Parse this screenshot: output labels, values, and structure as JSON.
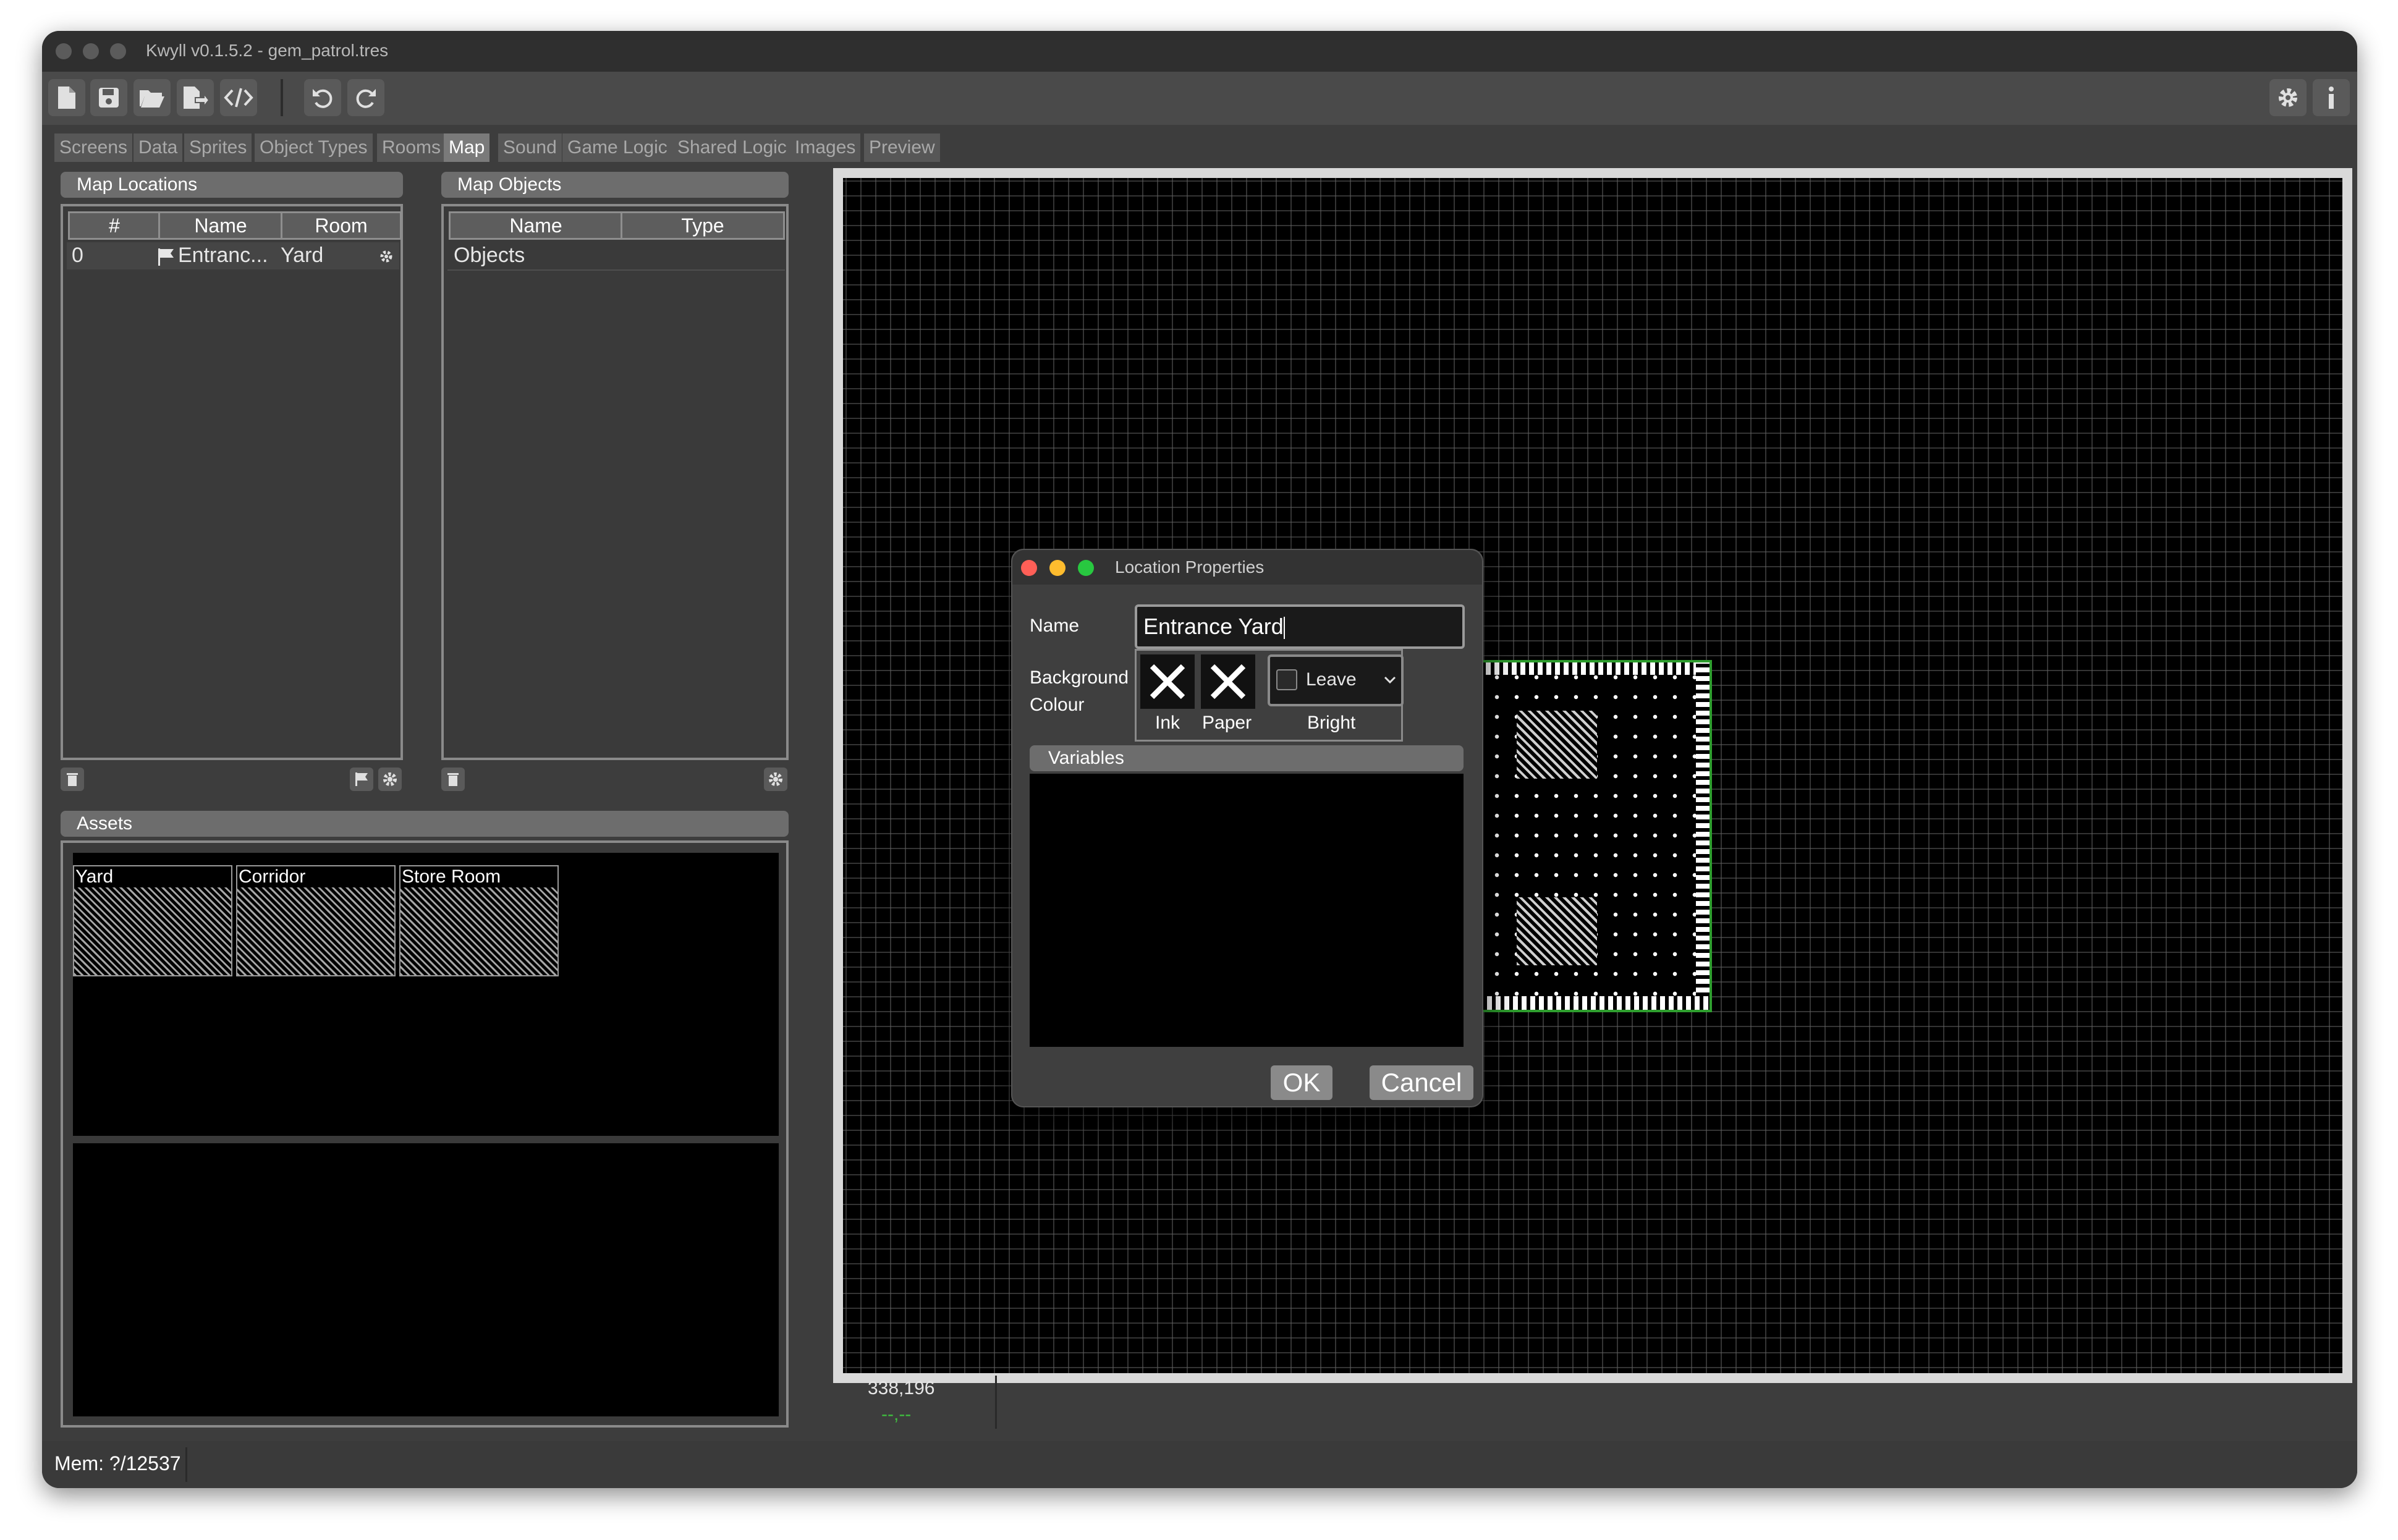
{
  "window": {
    "title": "Kwyll v0.1.5.2 - gem_patrol.tres"
  },
  "toolbar": {
    "buttons": [
      "new-file-icon",
      "save-icon",
      "open-folder-icon",
      "export-icon",
      "code-icon",
      "undo-icon",
      "redo-icon",
      "settings-icon",
      "info-icon"
    ]
  },
  "tabs": [
    "Screens",
    "Data",
    "Sprites",
    "Object Types",
    "Rooms",
    "Map",
    "Sound",
    "Game Logic",
    "Shared Logic",
    "Images",
    "Preview"
  ],
  "active_tab": "Map",
  "map_locations": {
    "title": "Map Locations",
    "columns": [
      "#",
      "Name",
      "Room"
    ],
    "rows": [
      {
        "index": "0",
        "name": "Entranc...",
        "room": "Yard"
      }
    ]
  },
  "map_objects": {
    "title": "Map Objects",
    "columns": [
      "Name",
      "Type"
    ],
    "rows": [
      {
        "name": "Objects",
        "type": ""
      }
    ]
  },
  "assets": {
    "title": "Assets",
    "items": [
      "Yard",
      "Corridor",
      "Store Room"
    ]
  },
  "canvas": {
    "coords": "338,196",
    "cursor": "--,--",
    "accent": "#2e9e2e"
  },
  "dialog": {
    "title": "Location Properties",
    "name_label": "Name",
    "name_value": "Entrance Yard",
    "bg_label_1": "Background",
    "bg_label_2": "Colour",
    "ink_label": "Ink",
    "paper_label": "Paper",
    "bright_label": "Bright",
    "bright_value": "Leave",
    "variables_label": "Variables",
    "ok_label": "OK",
    "cancel_label": "Cancel"
  },
  "status": {
    "mem": "Mem: ?/12537"
  }
}
